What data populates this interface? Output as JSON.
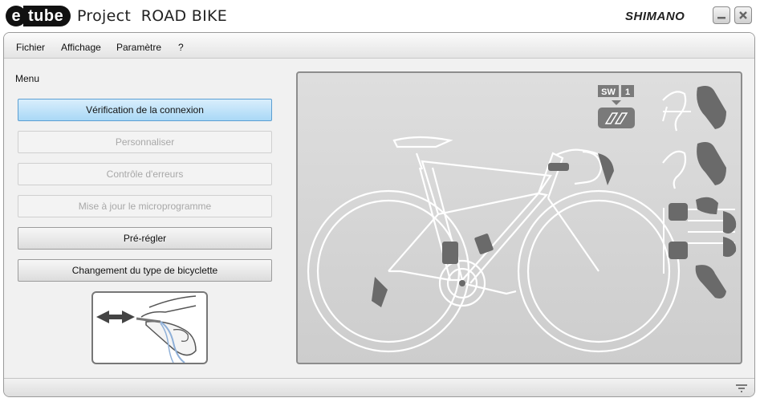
{
  "titlebar": {
    "logo_e": "e",
    "logo_word": "tube",
    "title": "Project  ROAD BIKE",
    "brand": "SHIMANO"
  },
  "menubar": {
    "items": [
      "Fichier",
      "Affichage",
      "Paramètre",
      "?"
    ]
  },
  "sidebar": {
    "heading": "Menu",
    "buttons": [
      {
        "label": "Vérification de la connexion",
        "state": "active"
      },
      {
        "label": "Personnaliser",
        "state": "disabled"
      },
      {
        "label": "Contrôle d'erreurs",
        "state": "disabled"
      },
      {
        "label": "Mise à jour le microprogramme",
        "state": "disabled"
      },
      {
        "label": "Pré-régler",
        "state": "enabled"
      },
      {
        "label": "Changement du type de bicyclette",
        "state": "enabled"
      }
    ]
  },
  "diagram": {
    "badge_sw": "SW",
    "badge_num": "1"
  },
  "colors": {
    "active_button": "#a9d8f6",
    "panel_bg": "#d5d5d5",
    "line": "#ffffff",
    "component": "#6a6a6a"
  }
}
